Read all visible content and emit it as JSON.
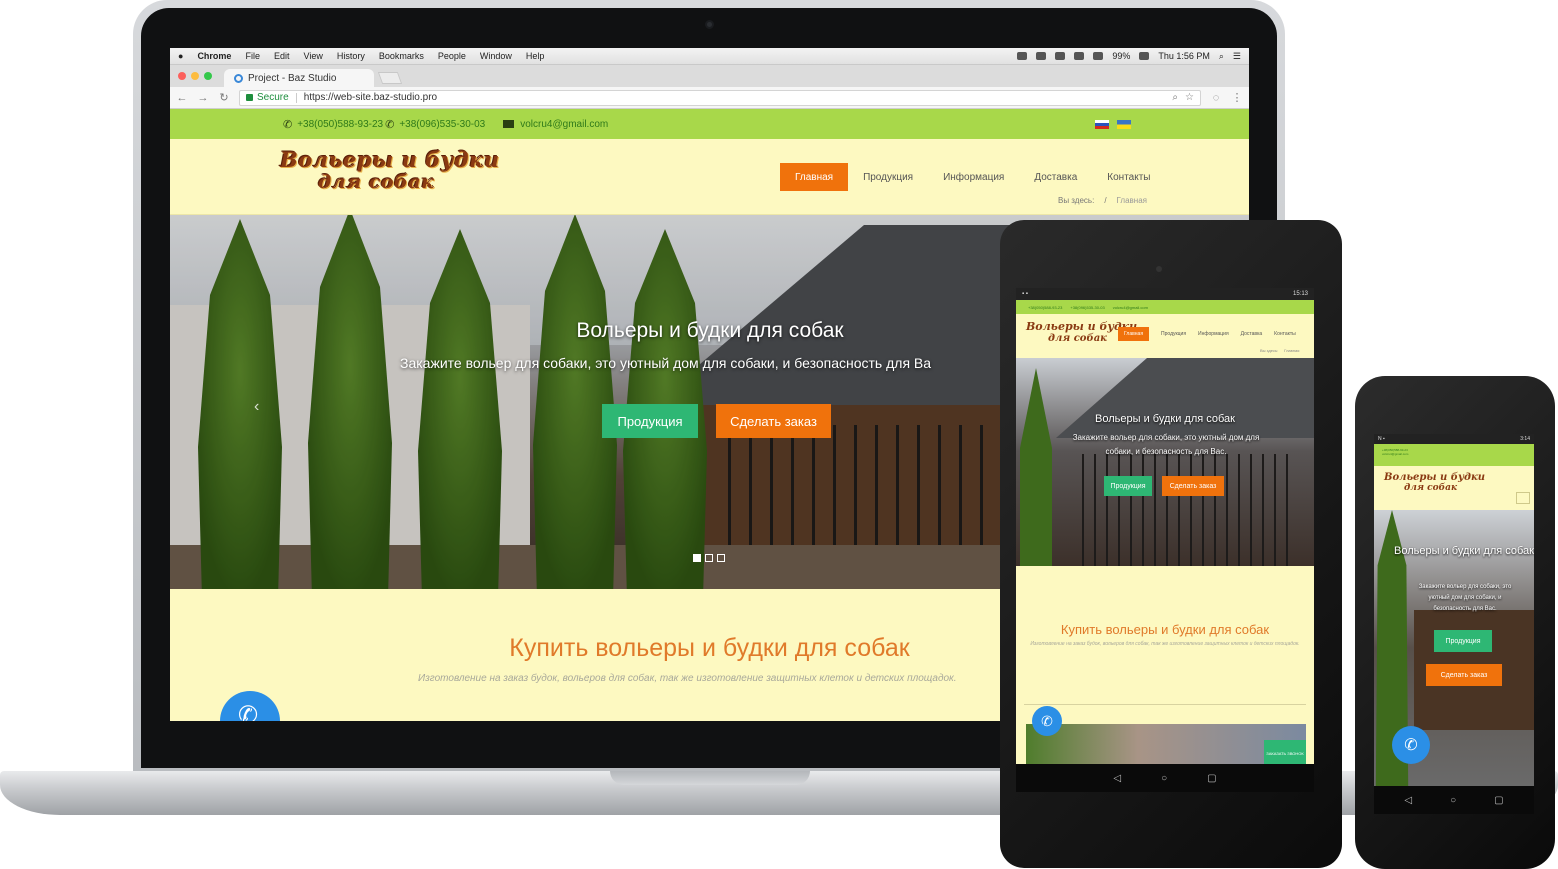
{
  "mac_menubar": {
    "app": "Chrome",
    "menus": [
      "File",
      "Edit",
      "View",
      "History",
      "Bookmarks",
      "People",
      "Window",
      "Help"
    ],
    "battery": "99%",
    "clock": "Thu 1:56 PM"
  },
  "browser": {
    "tab_title": "Project - Baz Studio",
    "secure_label": "Secure",
    "url": "https://web-site.baz-studio.pro"
  },
  "site": {
    "phone1": "+38(050)588-93-23",
    "phone2": "+38(096)535-30-03",
    "email": "volcru4@gmail.com",
    "logo_line1": "Вольеры и будки",
    "logo_line2": "для собак",
    "nav": [
      "Главная",
      "Продукция",
      "Информация",
      "Доставка",
      "Контакты"
    ],
    "breadcrumb_label": "Вы здесь:",
    "breadcrumb_current": "Главная",
    "hero_title": "Вольеры и будки для собак",
    "hero_subtitle": "Закажите вольер для собаки, это уютный дом для собаки, и безопасность для Ва",
    "btn_products": "Продукция",
    "btn_order": "Сделать заказ",
    "section_title": "Купить вольеры и будки для собак",
    "section_subtitle": "Изготовление на заказ будок, вольеров для собак, так же изготовление защитных клеток и детских площадок."
  },
  "tablet": {
    "clock": "15:13",
    "hero_title": "Вольеры и будки для собак",
    "hero_subtitle": "Закажите вольер для собаки, это уютный дом для собаки, и безопасность для Вас.",
    "btn_products": "Продукция",
    "btn_order": "Сделать заказ",
    "section_title": "Купить вольеры и будки для собак",
    "section_subtitle": "Изготовление на заказ будок, вольеров для собак, так же изготовление защитных клеток и детских площадок.",
    "call_order": "ЗАКАЗАТЬ ЗВОНОК"
  },
  "phone": {
    "clock": "3:14",
    "hero_title": "Вольеры и будки для собак",
    "hero_subtitle": "Закажите вольер для собаки, это уютный дом для собаки, и безопасность для Вас.",
    "btn_products": "Продукция",
    "btn_order": "Сделать заказ"
  },
  "android_nav": {
    "back": "◁",
    "home": "○",
    "recents": "▢"
  },
  "colors": {
    "topbar_green": "#a8d84a",
    "page_cream": "#fdf9c1",
    "accent_orange": "#f0720c",
    "button_green": "#2eb774",
    "call_blue": "#2b8fe6",
    "heading_orange": "#e07a2a"
  }
}
